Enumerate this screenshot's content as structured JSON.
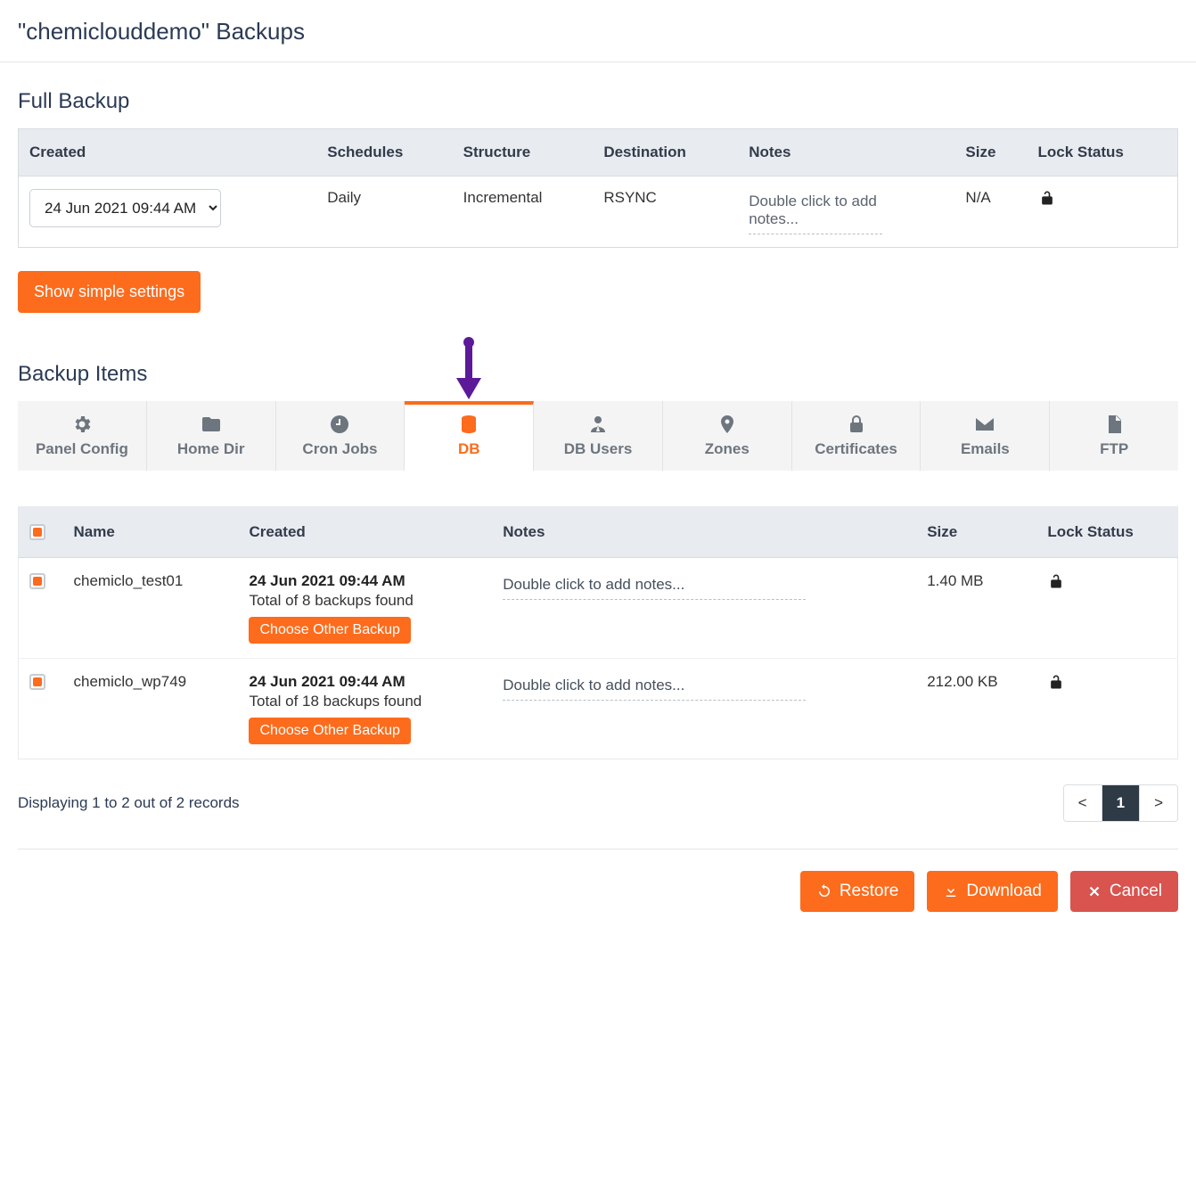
{
  "page_title": "\"chemiclouddemo\" Backups",
  "full_backup": {
    "section_title": "Full Backup",
    "headers": {
      "created": "Created",
      "schedules": "Schedules",
      "structure": "Structure",
      "destination": "Destination",
      "notes": "Notes",
      "size": "Size",
      "lock": "Lock Status"
    },
    "row": {
      "created_selected": "24 Jun 2021 09:44 AM",
      "schedules": "Daily",
      "structure": "Incremental",
      "destination": "RSYNC",
      "notes_placeholder": "Double click to add notes...",
      "size": "N/A"
    }
  },
  "show_simple_label": "Show simple settings",
  "backup_items": {
    "section_title": "Backup Items",
    "tabs": [
      {
        "id": "panel-config",
        "label": "Panel Config"
      },
      {
        "id": "home-dir",
        "label": "Home Dir"
      },
      {
        "id": "cron-jobs",
        "label": "Cron Jobs"
      },
      {
        "id": "db",
        "label": "DB",
        "active": true
      },
      {
        "id": "db-users",
        "label": "DB Users"
      },
      {
        "id": "zones",
        "label": "Zones"
      },
      {
        "id": "certificates",
        "label": "Certificates"
      },
      {
        "id": "emails",
        "label": "Emails"
      },
      {
        "id": "ftp",
        "label": "FTP"
      }
    ],
    "headers": {
      "name": "Name",
      "created": "Created",
      "notes": "Notes",
      "size": "Size",
      "lock": "Lock Status"
    },
    "rows": [
      {
        "name": "chemiclo_test01",
        "created_dt": "24 Jun 2021 09:44 AM",
        "created_sub": "Total of 8 backups found",
        "choose_label": "Choose Other Backup",
        "notes_placeholder": "Double click to add notes...",
        "size": "1.40 MB"
      },
      {
        "name": "chemiclo_wp749",
        "created_dt": "24 Jun 2021 09:44 AM",
        "created_sub": "Total of 18 backups found",
        "choose_label": "Choose Other Backup",
        "notes_placeholder": "Double click to add notes...",
        "size": "212.00 KB"
      }
    ]
  },
  "pagination": {
    "display_text": "Displaying 1 to 2 out of 2 records",
    "prev": "<",
    "current": "1",
    "next": ">"
  },
  "actions": {
    "restore": "Restore",
    "download": "Download",
    "cancel": "Cancel"
  }
}
